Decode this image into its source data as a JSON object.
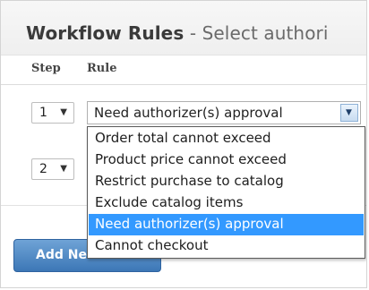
{
  "header": {
    "title_bold": "Workflow Rules",
    "title_sep": " - ",
    "title_rest": "Select authori"
  },
  "table": {
    "col_step": "Step",
    "col_rule": "Rule"
  },
  "rows": [
    {
      "step": "1",
      "rule": "Need authorizer(s) approval"
    },
    {
      "step": "2"
    }
  ],
  "dropdown": {
    "options": [
      "Order total cannot exceed",
      "Product price cannot exceed",
      "Restrict purchase to catalog",
      "Exclude catalog items",
      "Need authorizer(s) approval",
      "Cannot checkout"
    ],
    "selected": "Need authorizer(s) approval"
  },
  "actions": {
    "add_rule_label": "Add New Rule"
  },
  "colors": {
    "accent_blue": "#3399ff",
    "button_blue": "#4a86c4"
  }
}
